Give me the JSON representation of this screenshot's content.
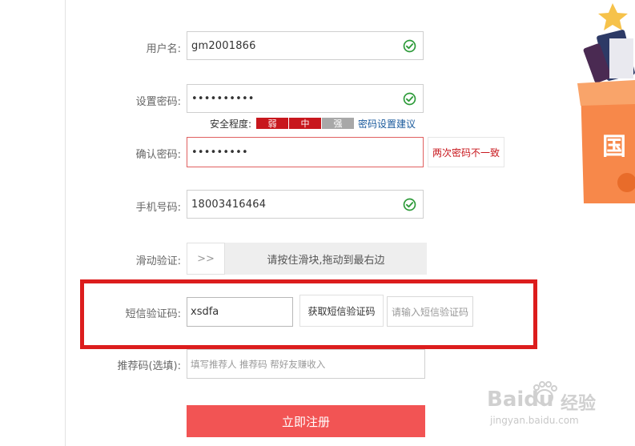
{
  "form": {
    "username": {
      "label": "用户名:",
      "value": "gm2001866",
      "valid": true
    },
    "password": {
      "label": "设置密码:",
      "value": "••••••••••",
      "valid": true
    },
    "strength": {
      "label": "安全程度:",
      "levels": [
        {
          "text": "弱",
          "color": "#c8171d"
        },
        {
          "text": "中",
          "color": "#c8171d"
        },
        {
          "text": "强",
          "color": "#a8a8a8"
        }
      ],
      "advice_link": "密码设置建议"
    },
    "confirm": {
      "label": "确认密码:",
      "value": "•••••••••",
      "error": "两次密码不一致"
    },
    "phone": {
      "label": "手机号码:",
      "value": "18003416464",
      "valid": true
    },
    "slider": {
      "label": "滑动验证:",
      "knob": ">>",
      "hint": "请按住滑块,拖动到最右边"
    },
    "sms": {
      "label": "短信验证码:",
      "value": "xsdfa",
      "get_code_button": "获取短信验证码",
      "hint": "请输入短信验证码"
    },
    "referral": {
      "label": "推荐码(选填):",
      "placeholder": "填写推荐人 推荐码 帮好友赚收入"
    },
    "submit": "立即注册"
  },
  "promo": {
    "text": "国"
  },
  "watermark": {
    "brand": "Baidu",
    "cn": "经验",
    "url": "jingyan.baidu.com"
  },
  "colors": {
    "accent": "#f25454",
    "error": "#c8171d",
    "valid": "#2e9b3a",
    "highlight": "#dc1d1d"
  }
}
